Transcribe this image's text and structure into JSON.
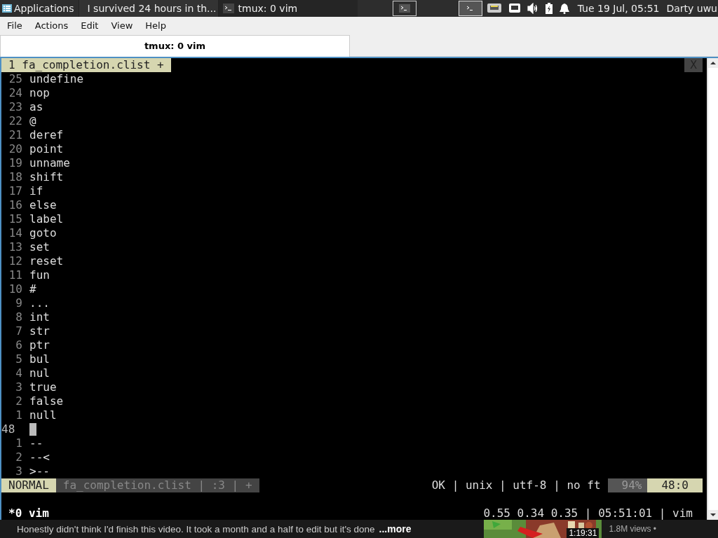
{
  "panel": {
    "applications": "Applications",
    "tasks": [
      {
        "title": "I survived 24 hours in th...",
        "kind": "browser",
        "selected": false
      },
      {
        "title": "tmux: 0 vim",
        "kind": "terminal",
        "selected": true
      }
    ],
    "workspaces": [
      {
        "selected": false
      },
      {
        "selected": true
      }
    ],
    "clock": "Tue 19 Jul, 05:51",
    "user": "Darty uwu"
  },
  "menu": [
    "File",
    "Actions",
    "Edit",
    "View",
    "Help"
  ],
  "tab": {
    "title": "tmux: 0 vim"
  },
  "vim": {
    "tabline": {
      "label": "1 fa_completion.clist +",
      "close": "X"
    },
    "lines": [
      {
        "kind": "relative",
        "number": "25",
        "text": "undefine"
      },
      {
        "kind": "relative",
        "number": "24",
        "text": "nop"
      },
      {
        "kind": "relative",
        "number": "23",
        "text": "as"
      },
      {
        "kind": "relative",
        "number": "22",
        "text": "@"
      },
      {
        "kind": "relative",
        "number": "21",
        "text": "deref"
      },
      {
        "kind": "relative",
        "number": "20",
        "text": "point"
      },
      {
        "kind": "relative",
        "number": "19",
        "text": "unname"
      },
      {
        "kind": "relative",
        "number": "18",
        "text": "shift"
      },
      {
        "kind": "relative",
        "number": "17",
        "text": "if"
      },
      {
        "kind": "relative",
        "number": "16",
        "text": "else"
      },
      {
        "kind": "relative",
        "number": "15",
        "text": "label"
      },
      {
        "kind": "relative",
        "number": "14",
        "text": "goto"
      },
      {
        "kind": "relative",
        "number": "13",
        "text": "set"
      },
      {
        "kind": "relative",
        "number": "12",
        "text": "reset"
      },
      {
        "kind": "relative",
        "number": "11",
        "text": "fun"
      },
      {
        "kind": "relative",
        "number": "10",
        "text": "#"
      },
      {
        "kind": "relative",
        "number": "9",
        "text": "..."
      },
      {
        "kind": "relative",
        "number": "8",
        "text": "int"
      },
      {
        "kind": "relative",
        "number": "7",
        "text": "str"
      },
      {
        "kind": "relative",
        "number": "6",
        "text": "ptr"
      },
      {
        "kind": "relative",
        "number": "5",
        "text": "bul"
      },
      {
        "kind": "relative",
        "number": "4",
        "text": "nul"
      },
      {
        "kind": "relative",
        "number": "3",
        "text": "true"
      },
      {
        "kind": "relative",
        "number": "2",
        "text": "false"
      },
      {
        "kind": "relative",
        "number": "1",
        "text": "null"
      },
      {
        "kind": "current",
        "number": "48"
      },
      {
        "kind": "relative",
        "number": "1",
        "text": "--"
      },
      {
        "kind": "relative",
        "number": "2",
        "text": "--<"
      },
      {
        "kind": "relative",
        "number": "3",
        "text": ">--"
      }
    ],
    "statusline": {
      "mode": "NORMAL",
      "file": "fa_completion.clist | :3 | +",
      "info": "OK | unix | utf-8 | no ft",
      "percent": "94%",
      "position": "48:0"
    }
  },
  "tmux": {
    "window": "*0 vim",
    "status": "0.55 0.34 0.35 | 05:51:01 | vim"
  },
  "video": {
    "description": "Honestly didn't think I'd finish this video. It took a month and a half to edit but it's done",
    "more": "...more",
    "duration": "1:19:31",
    "views": "1.8M views •"
  }
}
